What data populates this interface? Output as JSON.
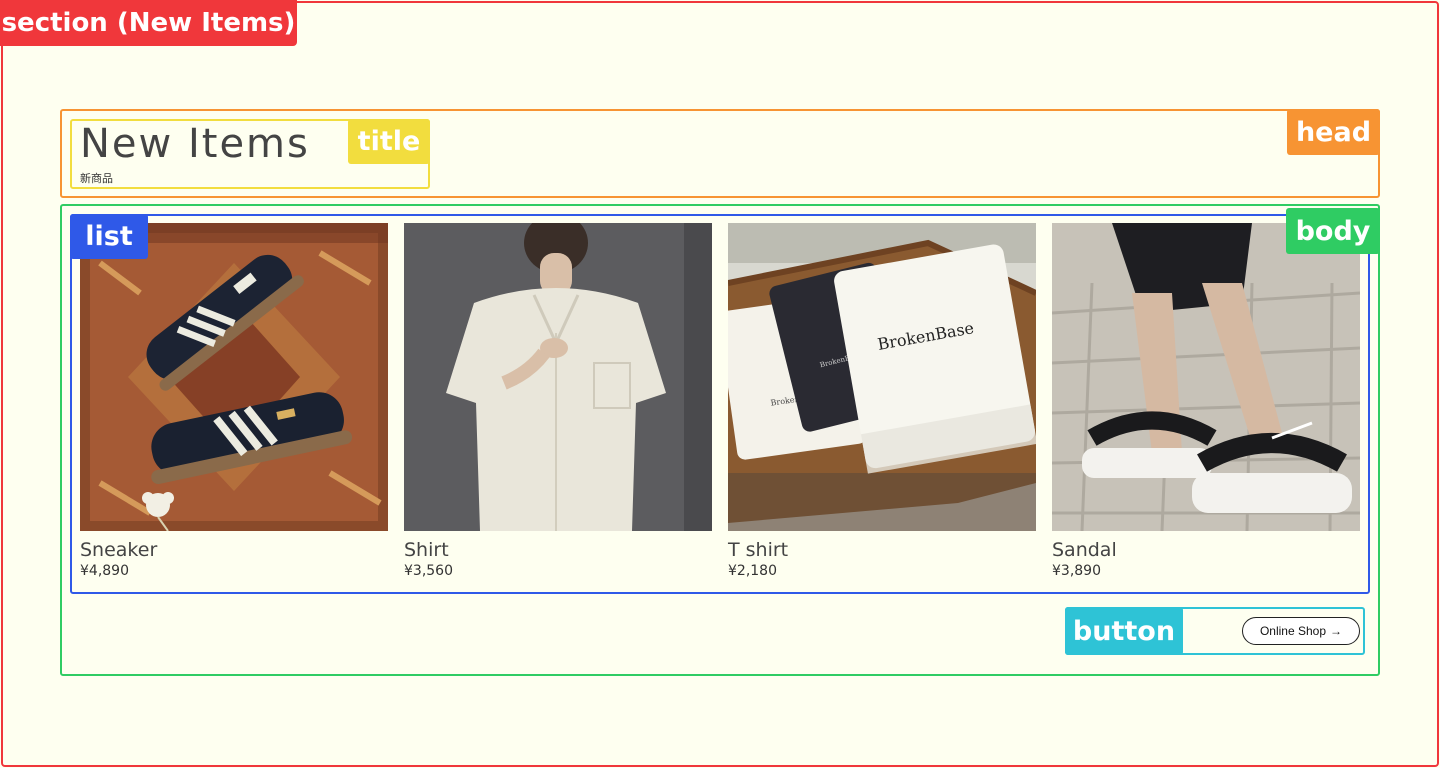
{
  "annotations": {
    "section": "section (New Items)",
    "head": "head",
    "title": "title",
    "list": "list",
    "body": "body",
    "button": "button"
  },
  "section": {
    "title": "New Items",
    "subtitle": "新商品"
  },
  "products": [
    {
      "name": "Sneaker",
      "price": "¥4,890",
      "image": "sneaker-photo"
    },
    {
      "name": "Shirt",
      "price": "¥3,560",
      "image": "shirt-photo"
    },
    {
      "name": "T shirt",
      "price": "¥2,180",
      "image": "tshirt-photo"
    },
    {
      "name": "Sandal",
      "price": "¥3,890",
      "image": "sandal-photo"
    }
  ],
  "product_image_text": {
    "brand": "BrokenBase"
  },
  "button": {
    "label": "Online Shop",
    "icon": "arrow-right-icon"
  },
  "colors": {
    "background": "#fefff0",
    "section": "#f0373b",
    "head": "#f79433",
    "title": "#f2dd3e",
    "list": "#2f59e8",
    "body": "#2fcc63",
    "button": "#2ec3d6"
  }
}
